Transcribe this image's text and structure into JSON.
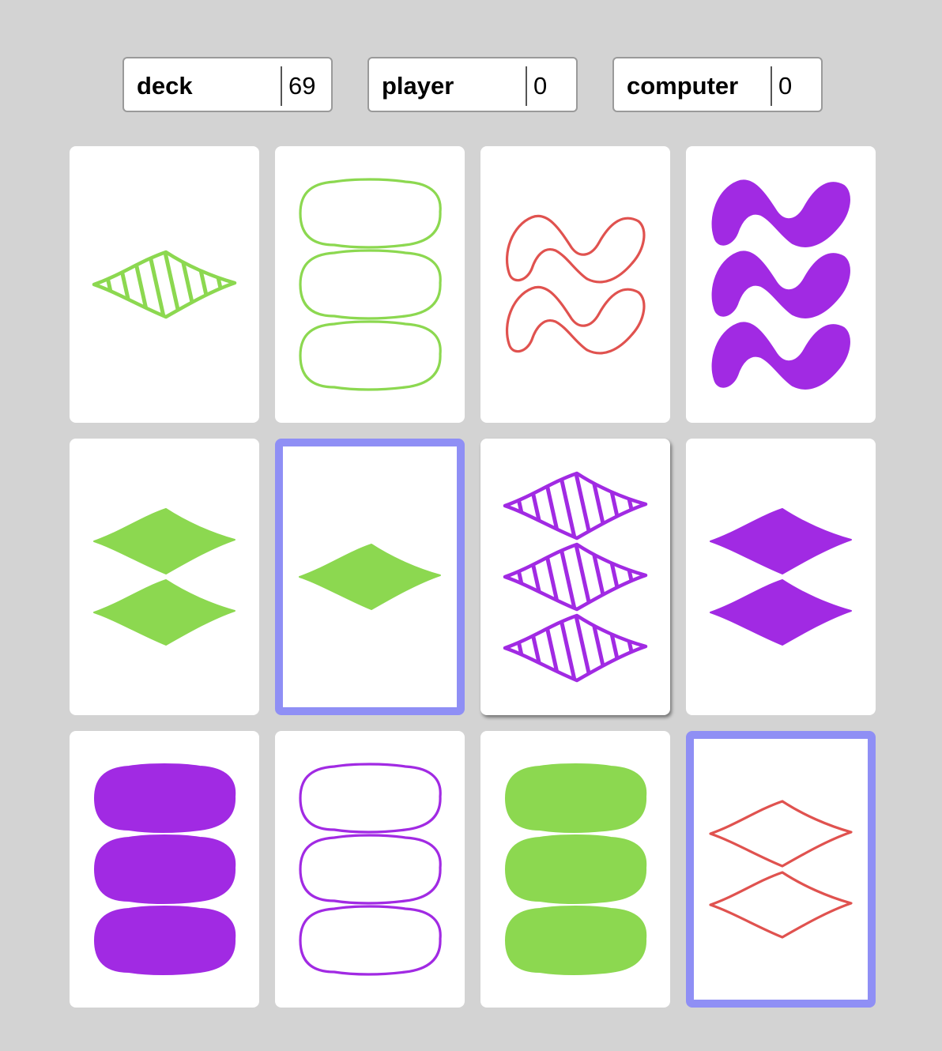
{
  "scores": [
    {
      "label": "deck",
      "value": "69"
    },
    {
      "label": "player",
      "value": "0"
    },
    {
      "label": "computer",
      "value": "0"
    }
  ],
  "colors": {
    "green": "#8cd850",
    "red": "#e0524f",
    "purple": "#a12ae3",
    "selected_border": "#8f8ff5",
    "background": "#d3d3d3"
  },
  "cards": [
    {
      "count": 1,
      "shape": "diamond",
      "fill": "striped",
      "color": "green",
      "selected": false
    },
    {
      "count": 3,
      "shape": "oval",
      "fill": "open",
      "color": "green",
      "selected": false
    },
    {
      "count": 2,
      "shape": "squiggle",
      "fill": "open",
      "color": "red",
      "selected": false
    },
    {
      "count": 3,
      "shape": "squiggle",
      "fill": "solid",
      "color": "purple",
      "selected": false
    },
    {
      "count": 2,
      "shape": "diamond",
      "fill": "solid",
      "color": "green",
      "selected": false
    },
    {
      "count": 1,
      "shape": "diamond",
      "fill": "solid",
      "color": "green",
      "selected": true
    },
    {
      "count": 3,
      "shape": "diamond",
      "fill": "striped",
      "color": "purple",
      "selected": false,
      "hover": true
    },
    {
      "count": 2,
      "shape": "diamond",
      "fill": "solid",
      "color": "purple",
      "selected": false
    },
    {
      "count": 3,
      "shape": "oval",
      "fill": "solid",
      "color": "purple",
      "selected": false
    },
    {
      "count": 3,
      "shape": "oval",
      "fill": "open",
      "color": "purple",
      "selected": false
    },
    {
      "count": 3,
      "shape": "oval",
      "fill": "solid",
      "color": "green",
      "selected": false
    },
    {
      "count": 2,
      "shape": "diamond",
      "fill": "open",
      "color": "red",
      "selected": true
    }
  ]
}
